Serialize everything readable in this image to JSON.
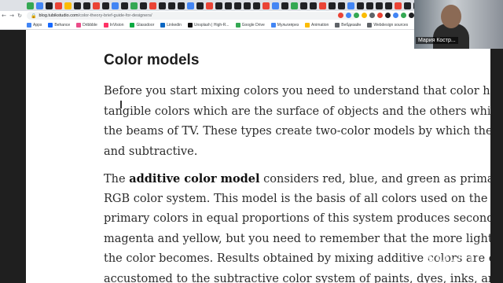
{
  "browser": {
    "url_host": "blog.tubikstudio.com",
    "url_path": "/color-theory-brief-guide-for-designers/",
    "nav": {
      "back": "←",
      "forward": "→",
      "reload": "↻",
      "secure": "🔒"
    },
    "tab_favicon_colors": [
      "#34a853",
      "#4285f4",
      "#202124",
      "#ea4335",
      "#fbbc04",
      "#202124",
      "#202124",
      "#ea4335",
      "#202124",
      "#4285f4",
      "#202124",
      "#34a853",
      "#202124",
      "#ea4335",
      "#202124",
      "#202124",
      "#202124",
      "#4285f4",
      "#202124",
      "#ea4335",
      "#202124",
      "#202124",
      "#202124",
      "#202124",
      "#202124",
      "#ea4335",
      "#4285f4",
      "#202124",
      "#34a853",
      "#202124",
      "#202124",
      "#ea4335",
      "#202124",
      "#202124",
      "#4285f4",
      "#202124",
      "#202124",
      "#202124",
      "#202124",
      "#ea4335",
      "#202124",
      "#202124",
      "#34a853",
      "#202124",
      "#202124",
      "#4285f4",
      "#202124",
      "#202124",
      "#202124",
      "#202124"
    ],
    "bookmarks": [
      {
        "label": "Apps",
        "color": "#4285f4"
      },
      {
        "label": "Behance",
        "color": "#1769ff"
      },
      {
        "label": "Dribbble",
        "color": "#ea4c89"
      },
      {
        "label": "InVision",
        "color": "#ff3366"
      },
      {
        "label": "Glassdoor",
        "color": "#0caa41"
      },
      {
        "label": "Linkedin",
        "color": "#0a66c2"
      },
      {
        "label": "Unsplash | High-R...",
        "color": "#111111"
      },
      {
        "label": "Google Drive",
        "color": "#34a853"
      },
      {
        "label": "Мультипрез",
        "color": "#4285f4"
      },
      {
        "label": "Animation",
        "color": "#fbbc04"
      },
      {
        "label": "Вебдизайн",
        "color": "#5f6368"
      },
      {
        "label": "Webdesign sources",
        "color": "#5f6368"
      },
      {
        "label": "Bookmarks",
        "color": "#5f6368"
      }
    ],
    "extension_colors": [
      "#ea4335",
      "#4285f4",
      "#34a853",
      "#fbbc04",
      "#5f6368",
      "#ea4335",
      "#202124",
      "#4285f4",
      "#34a853",
      "#202124"
    ]
  },
  "article": {
    "heading": "Color models",
    "paragraph1": [
      "Before you start mixing colors you need to understand that color has two diff",
      "tangible colors which are the surface of objects and the others which are proc",
      "the beams of TV. These types create two-color models by which the color whe",
      "and subtractive."
    ],
    "paragraph2": {
      "intro": "The ",
      "bold": "additive color model",
      "first_rest": " considers red, blue, and green as primary colors so i",
      "lines": [
        "RGB color system. This model is the basis of all colors used on the screen. Th",
        "primary colors in equal proportions of this system produces secondary colors",
        "magenta and yellow, but you need to remember that the more light you add, t",
        "the color becomes. Results obtained by mixing additive colors are often coun",
        "accustomed to the subtractive color system of paints, dyes, inks, and other ta"
      ]
    }
  },
  "video": {
    "participant_name": "Мария Костр..."
  },
  "watermark": "zoom"
}
